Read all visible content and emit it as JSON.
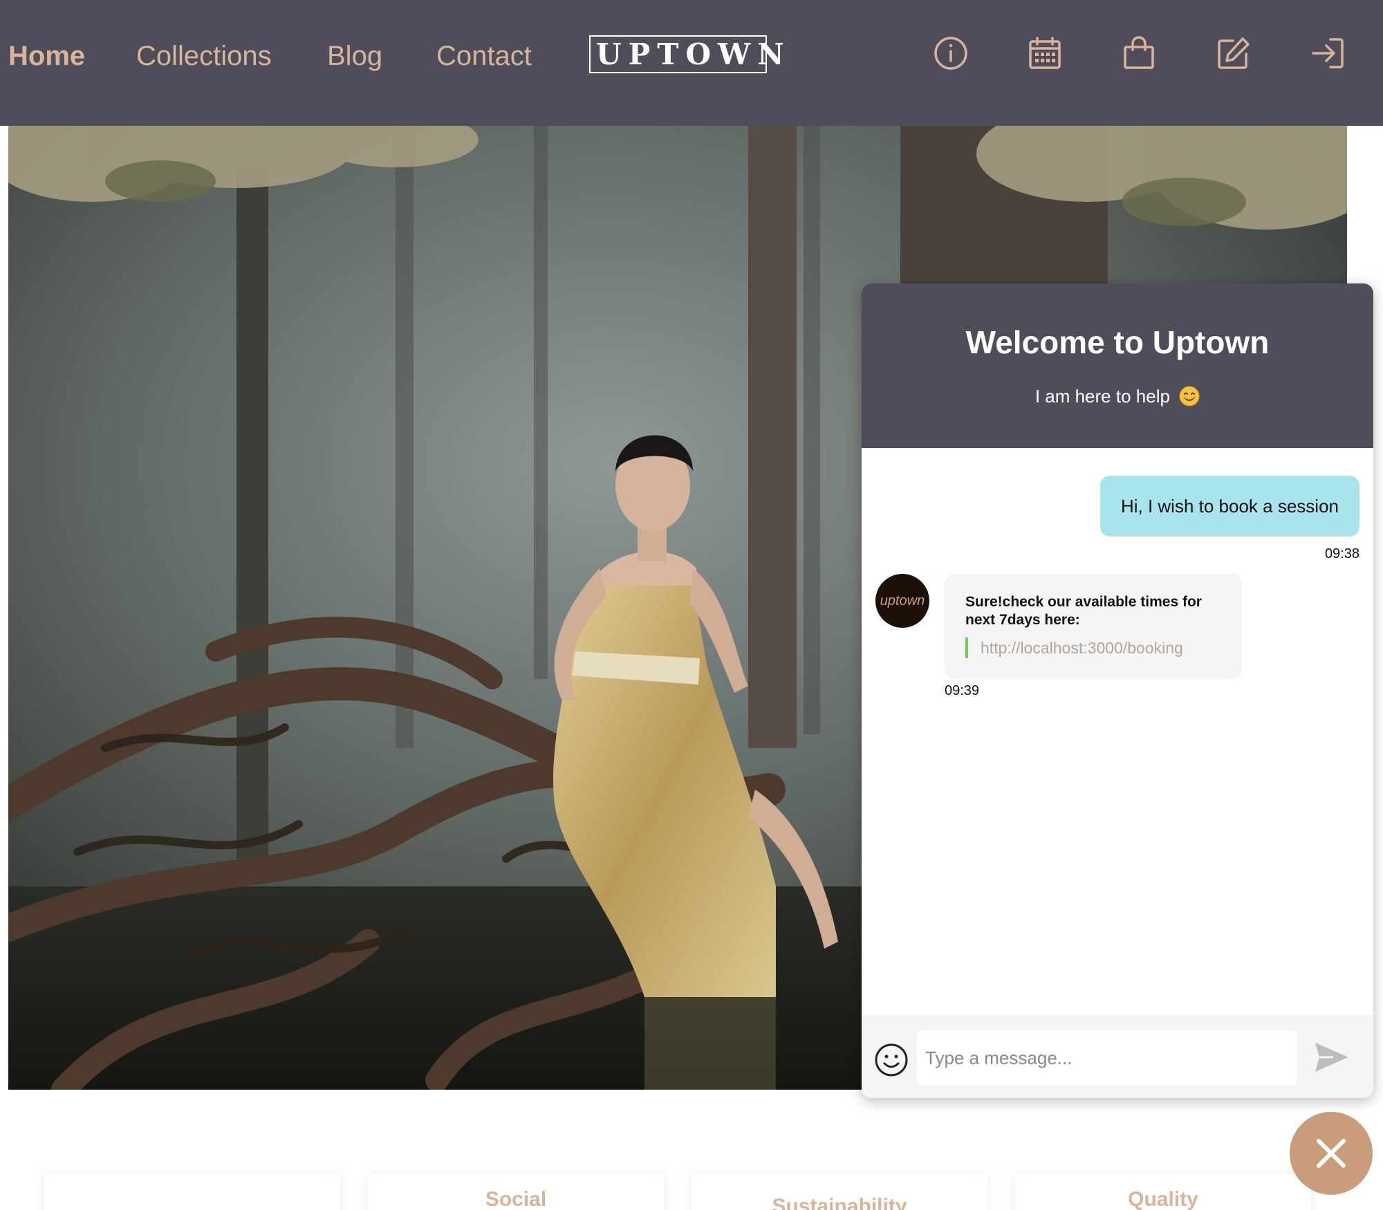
{
  "nav": {
    "links": [
      {
        "label": "Home",
        "active": true
      },
      {
        "label": "Collections",
        "active": false
      },
      {
        "label": "Blog",
        "active": false
      },
      {
        "label": "Contact",
        "active": false
      }
    ],
    "logo": "UPTOWN",
    "icons": [
      "info-icon",
      "calendar-icon",
      "shopping-bag-icon",
      "edit-icon",
      "sign-in-icon"
    ]
  },
  "hero": {
    "image": "woman-in-gold-gown-on-forest-roots"
  },
  "cards": [
    {
      "title": ""
    },
    {
      "title": "Social"
    },
    {
      "title": "Sustainability"
    },
    {
      "title": "Quality"
    }
  ],
  "chat": {
    "header": {
      "title": "Welcome to Uptown",
      "subtitle": "I am here to help",
      "emoji": "smiling-face-icon"
    },
    "messages": [
      {
        "from": "user",
        "text": "Hi, I wish to book a session",
        "time": "09:38"
      },
      {
        "from": "bot",
        "avatar": "uptown",
        "text": "Sure!check our available times for next 7days here:",
        "link": "http://localhost:3000/booking",
        "time": "09:39"
      }
    ],
    "input": {
      "placeholder": "Type a message...",
      "value": ""
    },
    "icons": {
      "emoji": "emoji-icon",
      "send": "send-icon",
      "close": "close-icon"
    }
  },
  "colors": {
    "nav_bg": "#4f4d5a",
    "accent": "#d8b49b",
    "user_bubble": "#a8e3ee",
    "bot_bubble": "#f4f5f6",
    "link_bar": "#6ccf5c",
    "close_button": "#c99d7c"
  }
}
